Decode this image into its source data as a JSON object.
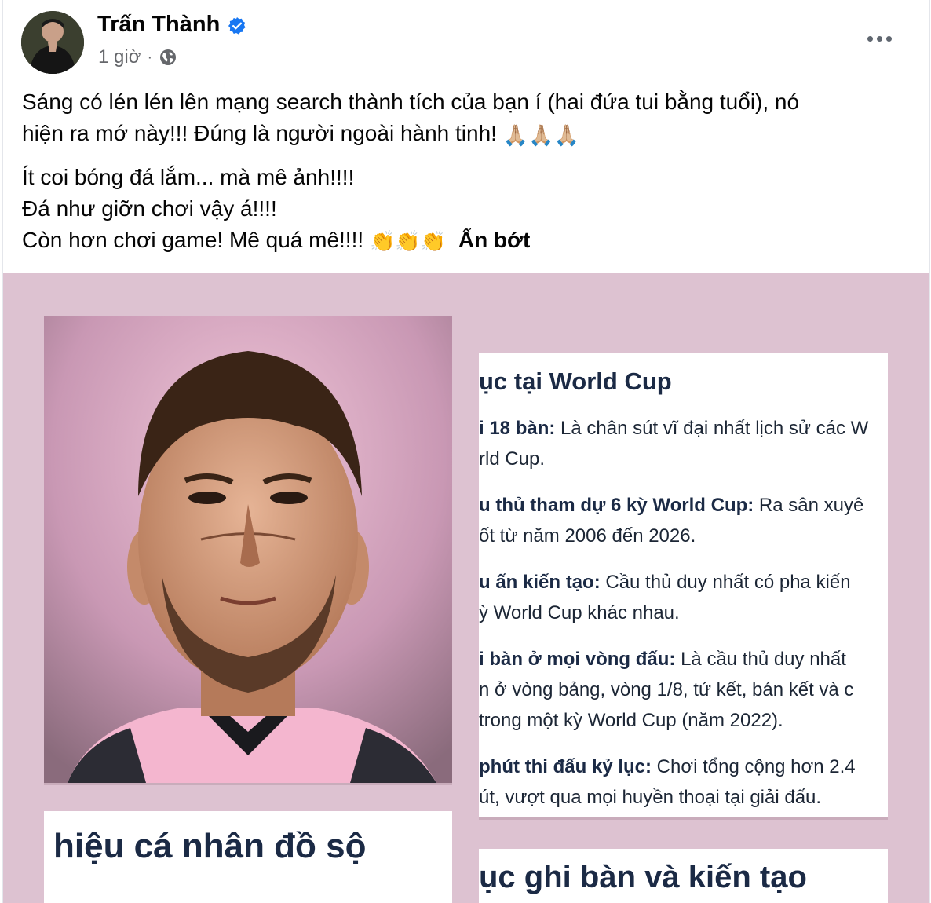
{
  "post": {
    "author": "Trấn Thành",
    "time": "1 giờ",
    "dot": "·",
    "paragraph1_line1": "Sáng có lén lén lên mạng search thành tích của bạn í (hai đứa tui bằng tuổi), nó",
    "paragraph1_line2": "hiện ra mớ này!!! Đúng là người ngoài hành tinh!",
    "pray_emojis": "🙏🏼🙏🏼🙏🏼",
    "line3": "Ít coi bóng đá lắm... mà mê ảnh!!!!",
    "line4": "Đá như giỡn chơi vậy á!!!!",
    "line5": "Còn hơn chơi game!  Mê quá mê!!!!",
    "clap_emojis": "👏👏👏",
    "see_less": "Ẩn bớt"
  },
  "icons": {
    "verified": "verified-badge-icon",
    "globe": "globe-icon",
    "more": "more-options-icon"
  },
  "colors": {
    "media_bg": "#ddc2d1",
    "verified_blue": "#1877f2",
    "heading_navy": "#1b2a45"
  },
  "media": {
    "wc_panel": {
      "title": "ục tại World Cup",
      "items": [
        {
          "bold": "i 18 bàn:",
          "text": " Là chân sút vĩ đại nhất lịch sử các W",
          "cont": "rld Cup."
        },
        {
          "bold": "u thủ tham dự 6 kỳ World Cup:",
          "text": " Ra sân xuyê",
          "cont": "ốt từ năm 2006 đến 2026."
        },
        {
          "bold": "u ấn kiến tạo:",
          "text": " Cầu thủ duy nhất có pha kiến",
          "cont": "ỳ World Cup khác nhau."
        },
        {
          "bold": "i bàn ở mọi vòng đấu:",
          "text": " Là cầu thủ duy nhất",
          "cont": "n ở vòng bảng, vòng 1/8, tứ kết, bán kết và c",
          "cont2": " trong một kỳ World Cup (năm 2022)."
        },
        {
          "bold": "phút thi đấu kỷ lục:",
          "text": " Chơi tổng cộng hơn 2.4",
          "cont": "út, vượt qua mọi huyền thoại tại giải đấu."
        }
      ]
    },
    "left_heading": "hiệu cá nhân đồ sộ",
    "right_heading": "ục ghi bàn và kiến tạo"
  }
}
